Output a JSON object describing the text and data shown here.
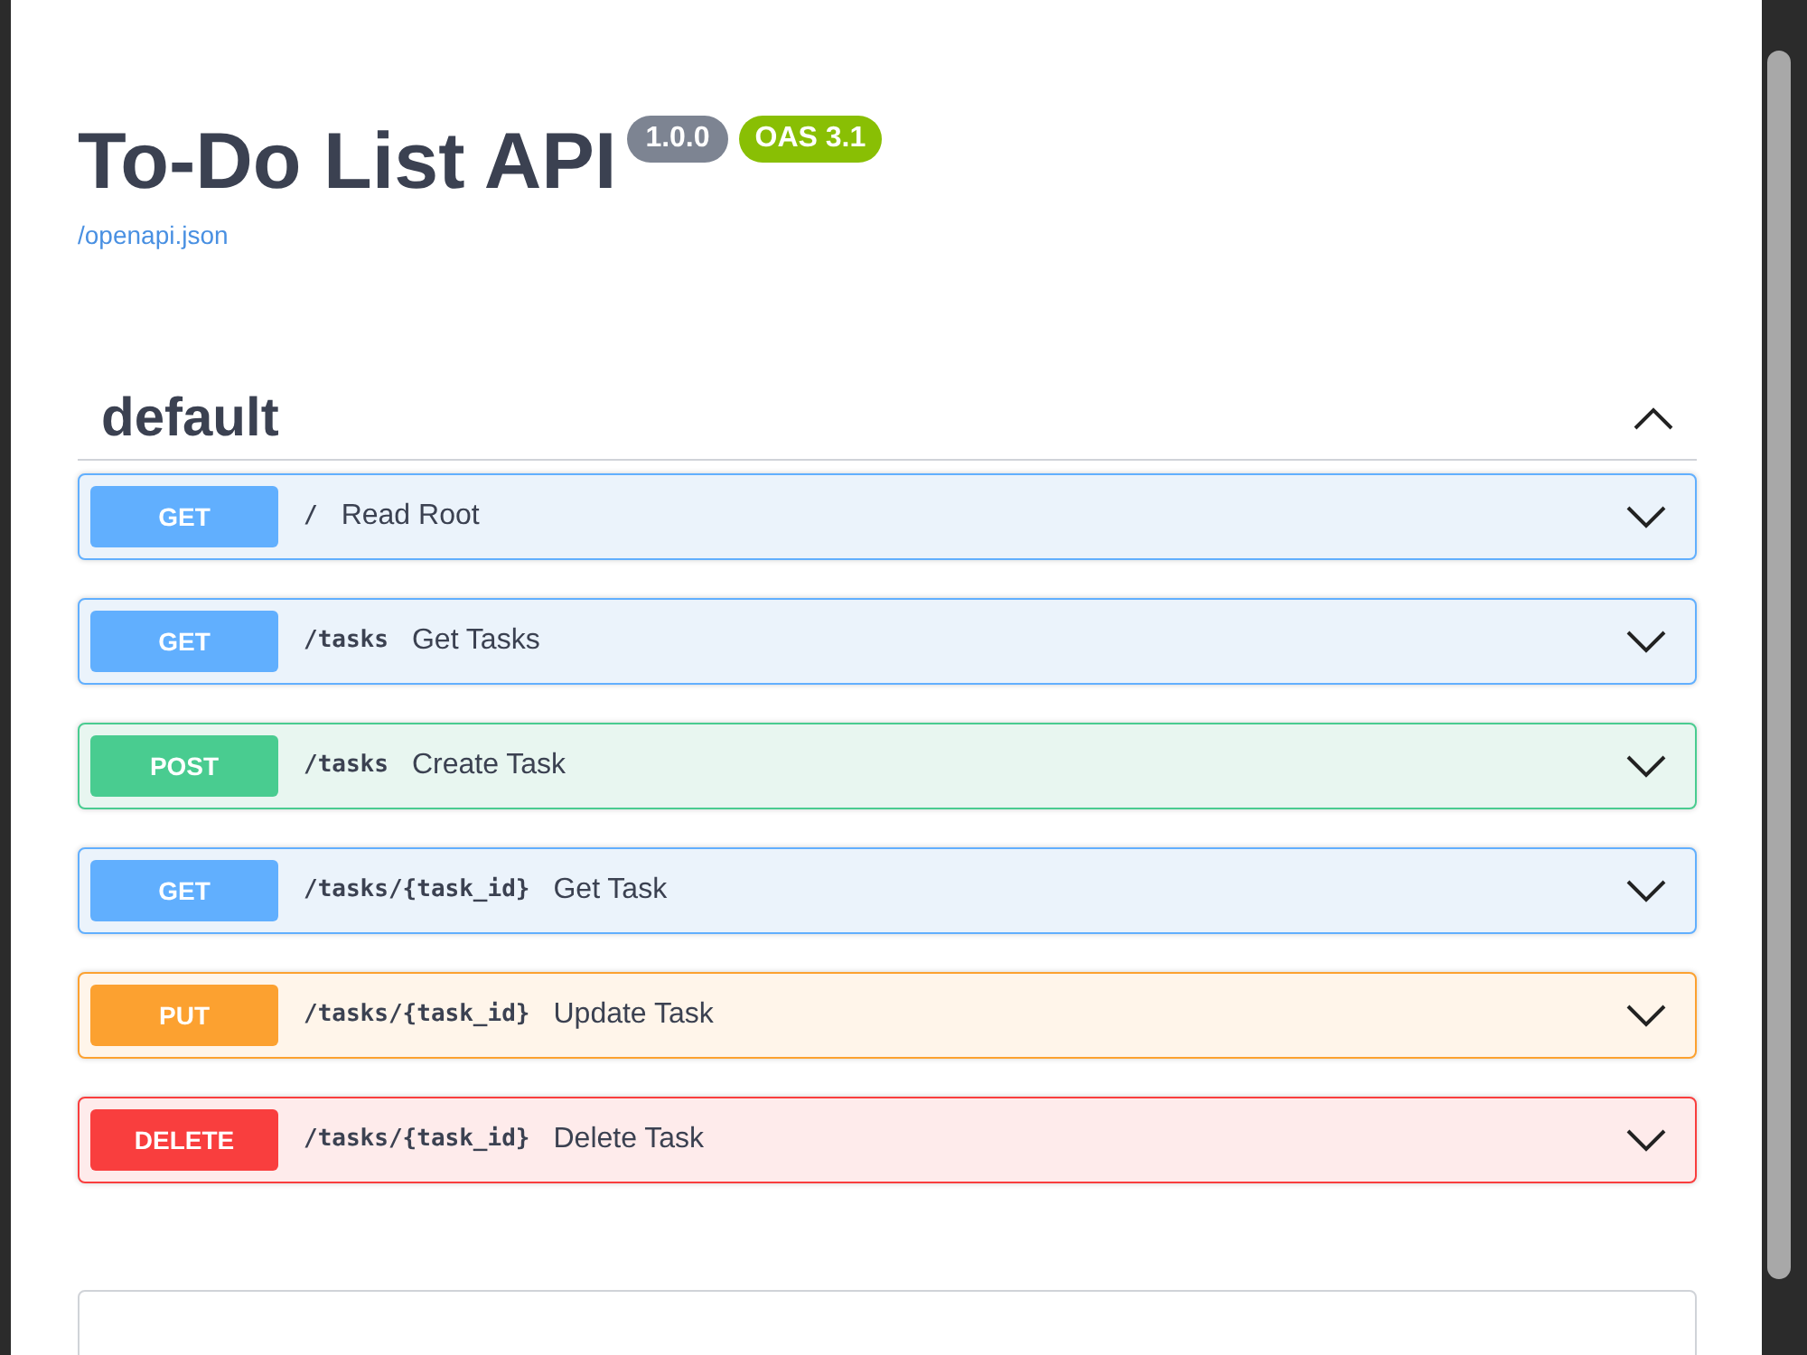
{
  "info": {
    "title": "To-Do List API",
    "version": "1.0.0",
    "oas": "OAS 3.1",
    "spec_link": "/openapi.json"
  },
  "section": {
    "name": "default",
    "expanded": true
  },
  "operations": [
    {
      "kind": "get",
      "method": "GET",
      "path": "/",
      "summary": "Read Root"
    },
    {
      "kind": "get",
      "method": "GET",
      "path": "/tasks",
      "summary": "Get Tasks"
    },
    {
      "kind": "post",
      "method": "POST",
      "path": "/tasks",
      "summary": "Create Task"
    },
    {
      "kind": "get",
      "method": "GET",
      "path": "/tasks/{task_id}",
      "summary": "Get Task"
    },
    {
      "kind": "put",
      "method": "PUT",
      "path": "/tasks/{task_id}",
      "summary": "Update Task"
    },
    {
      "kind": "delete",
      "method": "DELETE",
      "path": "/tasks/{task_id}",
      "summary": "Delete Task"
    }
  ]
}
